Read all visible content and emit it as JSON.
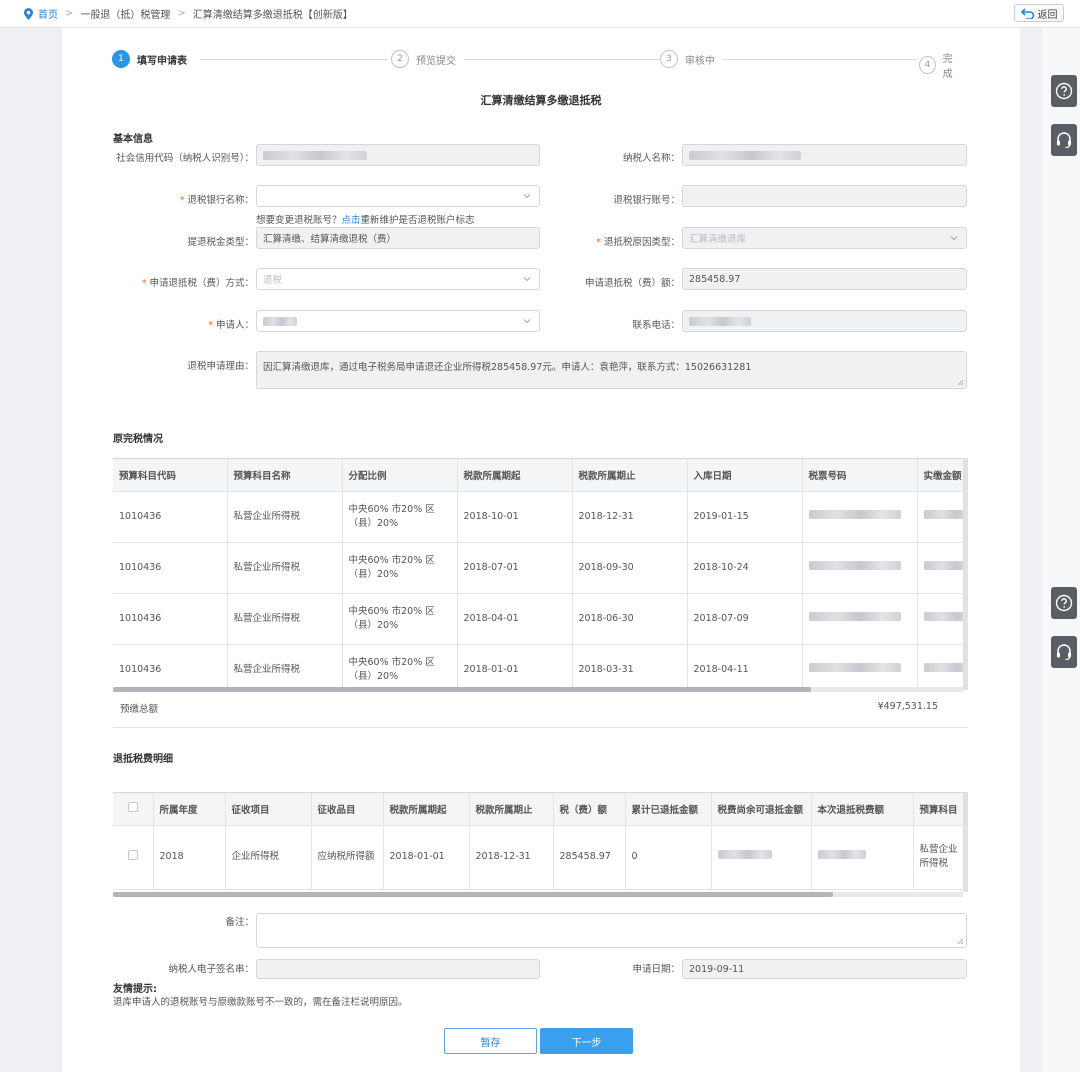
{
  "breadcrumb": {
    "home": "首页",
    "level1": "一般退（抵）税管理",
    "level2": "汇算清缴结算多缴退抵税【创新版】"
  },
  "back_label": "返回",
  "steps": [
    {
      "num": "1",
      "label": "填写申请表"
    },
    {
      "num": "2",
      "label": "预览提交"
    },
    {
      "num": "3",
      "label": "审核中"
    },
    {
      "num": "4",
      "label": "完成"
    }
  ],
  "form_title": "汇算清缴结算多缴退抵税",
  "basic_info": {
    "section_title": "基本信息",
    "credit_code_label": "社会信用代码（纳税人识别号）：",
    "taxpayer_name_label": "纳税人名称：",
    "refund_bank_label": "退税银行名称：",
    "refund_account_label": "退税银行账号：",
    "hint_prefix": "想要变更退税账号？",
    "hint_link": "点击",
    "hint_suffix": "重新维护是否退税账户标志",
    "refund_type_label": "提退税金类型：",
    "refund_type_value": "汇算清缴、结算清缴退税（费）",
    "reason_type_label": "退抵税原因类型：",
    "reason_type_value": "汇算清缴退库",
    "method_label": "申请退抵税（费）方式：",
    "method_value": "退税",
    "amount_label": "申请退抵税（费）额：",
    "amount_value": "285458.97",
    "applicant_label": "申请人：",
    "phone_label": "联系电话：",
    "reason_label": "退税申请理由：",
    "reason_value": "因汇算清缴退库，通过电子税务局申请退还企业所得税285458.97元。申请人：袁艳萍，联系方式：15026631281"
  },
  "original_tax": {
    "section_title": "原完税情况",
    "headers": [
      "预算科目代码",
      "预算科目名称",
      "分配比例",
      "税款所属期起",
      "税款所属期止",
      "入库日期",
      "税票号码",
      "实缴金额"
    ],
    "rows": [
      {
        "code": "1010436",
        "name": "私营企业所得税",
        "ratio": "中央60% 市20% 区（县）20%",
        "start": "2018-10-01",
        "end": "2018-12-31",
        "date": "2019-01-15"
      },
      {
        "code": "1010436",
        "name": "私营企业所得税",
        "ratio": "中央60% 市20% 区（县）20%",
        "start": "2018-07-01",
        "end": "2018-09-30",
        "date": "2018-10-24"
      },
      {
        "code": "1010436",
        "name": "私营企业所得税",
        "ratio": "中央60% 市20% 区（县）20%",
        "start": "2018-04-01",
        "end": "2018-06-30",
        "date": "2018-07-09"
      },
      {
        "code": "1010436",
        "name": "私营企业所得税",
        "ratio": "中央60% 市20% 区（县）20%",
        "start": "2018-01-01",
        "end": "2018-03-31",
        "date": "2018-04-11"
      }
    ],
    "total_label": "预缴总额",
    "total_value": "¥497,531.15"
  },
  "refund_detail": {
    "section_title": "退抵税费明细",
    "headers": [
      "所属年度",
      "征收项目",
      "征收品目",
      "税款所属期起",
      "税款所属期止",
      "税（费）额",
      "累计已退抵金额",
      "税费尚余可退抵金额",
      "本次退抵税费额",
      "预算科目"
    ],
    "row": {
      "year": "2018",
      "item": "企业所得税",
      "sub_item": "应纳税所得额",
      "start": "2018-01-01",
      "end": "2018-12-31",
      "amount": "285458.97",
      "refunded": "0",
      "budget": "私营企业所得税"
    }
  },
  "remark_label": "备注：",
  "signature_label": "纳税人电子签名串：",
  "apply_date_label": "申请日期：",
  "apply_date_value": "2019-09-11",
  "tips_title": "友情提示:",
  "tips_text": "退库申请人的退税账号与原缴款账号不一致的，需在备注栏说明原因。",
  "buttons": {
    "save": "暂存",
    "next": "下一步"
  },
  "colors": {
    "primary": "#2a97e6",
    "required": "#ec6a1e",
    "link": "#2a83d6"
  }
}
